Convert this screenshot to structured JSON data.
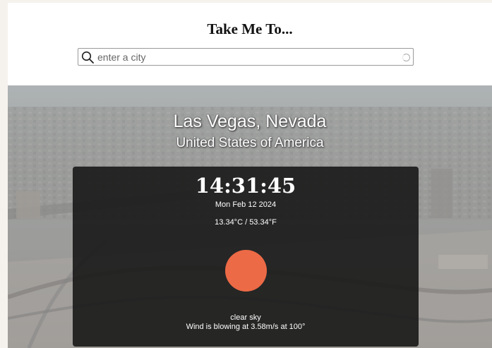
{
  "header": {
    "title": "Take Me To..."
  },
  "search": {
    "placeholder": "enter a city",
    "value": ""
  },
  "location": {
    "city": "Las Vegas, Nevada",
    "country": "United States of America"
  },
  "weather": {
    "time": "14:31:45",
    "date": "Mon Feb 12 2024",
    "temperature": "13.34°C / 53.34°F",
    "description": "clear sky",
    "wind": "Wind is blowing at 3.58m/s at 100°",
    "icon": "sun-icon",
    "icon_color": "#ec6a46"
  }
}
